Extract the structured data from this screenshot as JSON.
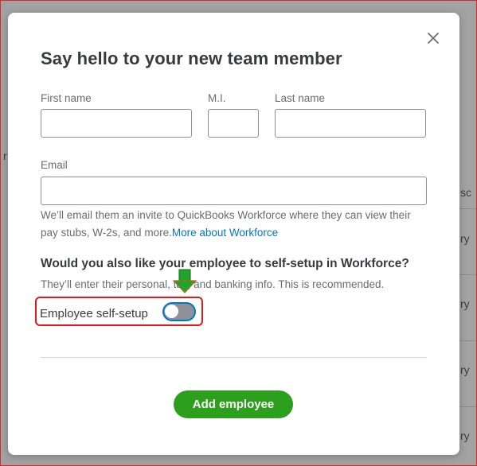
{
  "dialog": {
    "title": "Say hello to your new team member",
    "fields": {
      "first_name": {
        "label": "First name",
        "value": ""
      },
      "middle_initial": {
        "label": "M.I.",
        "value": ""
      },
      "last_name": {
        "label": "Last name",
        "value": ""
      },
      "email": {
        "label": "Email",
        "value": ""
      }
    },
    "email_help": "We’ll email them an invite to QuickBooks Workforce where they can view their pay stubs, W-2s, and more.",
    "email_help_link": "More about Workforce",
    "question": "Would you also like your employee to self-setup in Workforce?",
    "question_sub": "They’ll enter their personal, tax, and banking info. This is recommended.",
    "toggle": {
      "label": "Employee self-setup",
      "state": "off"
    },
    "primary_button": "Add employee"
  },
  "background": {
    "fragments": [
      "r",
      "sc",
      "ry",
      "ry",
      "ry",
      "ry"
    ]
  },
  "colors": {
    "primary": "#2ca01c",
    "link": "#0077c5",
    "highlight": "#e0191f"
  },
  "icons": {
    "close": "close-icon",
    "arrow": "arrow-down-icon"
  }
}
